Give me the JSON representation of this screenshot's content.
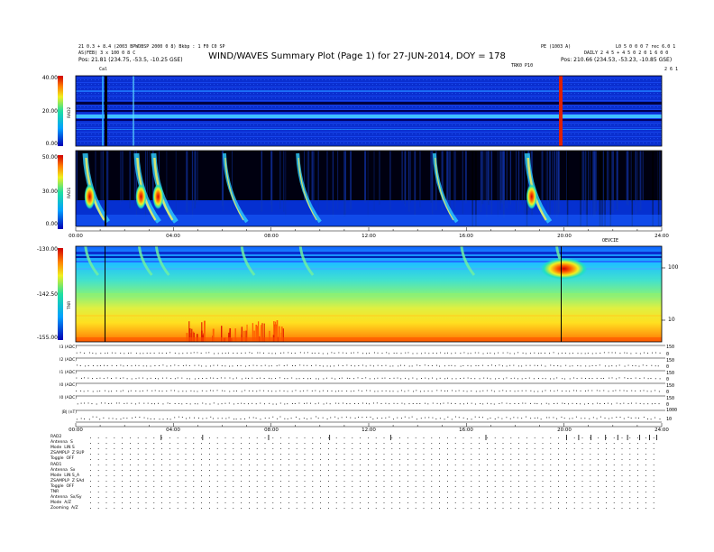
{
  "header": {
    "top_left_line1": "21 0.3 + 8.4 (2003 BPWDBSP 2000 0 8) Bkbp : 1 F0 C0 SP",
    "top_left_line2": "AS(FEB) 3 x 100 0 8 C",
    "position_left": "Pos:  21.81 (234.75, -53.5, -10.25 GSE)",
    "top_center_right": "PE (1003 A)",
    "top_right": "L0 5 0 0 0 7 rec 6.0 1",
    "daily_label": "DAILY  2 4 5 + 4 5 0 2 0 1 6 0 0",
    "position_right": "Pos:  210.66 (234.53, -53.23, -10.85 GSE)",
    "mid_marker": "TRK0 P10",
    "left_marker": "Cal",
    "top_right_tick": "2 6 1"
  },
  "title": "WIND/WAVES Summary Plot (Page 1) for 27-JUN-2014, DOY = 178",
  "panels": {
    "rad2": {
      "label": "RAD2",
      "ticks": [
        "40.00",
        "20.00",
        "0.00"
      ]
    },
    "rad1": {
      "label": "RAD1",
      "ticks": [
        "50.00",
        "30.00",
        "0.00"
      ]
    },
    "tnr": {
      "label": "TNR",
      "ticks": [
        "-130.00",
        "-142.50",
        "-155.00"
      ],
      "right_ticks": [
        "100",
        "10"
      ]
    }
  },
  "time_axis_1": [
    "00:00",
    "04:00",
    "08:00",
    "12:00",
    "16:00",
    "20:00",
    "24:00"
  ],
  "axis1_right_label": "OEVCIE",
  "time_axis_2": [
    "00:00",
    "04:00",
    "08:00",
    "12:00",
    "16:00",
    "20:00",
    "24:00"
  ],
  "small_rows": [
    {
      "label": "I3 (ADC)",
      "right_ticks": [
        "150",
        "0"
      ]
    },
    {
      "label": "I2 (ADC)",
      "right_ticks": [
        "150",
        "0"
      ]
    },
    {
      "label": "I1 (ADC)",
      "right_ticks": [
        "150",
        "0"
      ]
    },
    {
      "label": "I0 (ADC)",
      "right_ticks": [
        "150",
        "0"
      ]
    },
    {
      "label": "I0 (ADC)",
      "right_ticks": [
        "150",
        "0"
      ]
    },
    {
      "label": "|B| (nT)",
      "right_ticks": [
        "1000",
        "10"
      ]
    }
  ],
  "params": [
    {
      "label": "RAD2",
      "value": ""
    },
    {
      "label": "Antenna",
      "value": "S"
    },
    {
      "label": "Mode",
      "value": "LIN S"
    },
    {
      "label": "ZSAMPLP",
      "value": "Z SUP"
    },
    {
      "label": "Toggle",
      "value": "OFF"
    },
    {
      "label": "RAD1",
      "value": ""
    },
    {
      "label": "Antenna",
      "value": "Sx"
    },
    {
      "label": "Mode",
      "value": "LIN S_A"
    },
    {
      "label": "ZSAMPLP",
      "value": "Z SAd"
    },
    {
      "label": "Toggle",
      "value": "OFF"
    },
    {
      "label": "TNR",
      "value": ""
    },
    {
      "label": "Antenna",
      "value": "Sx/Sy"
    },
    {
      "label": "Mode",
      "value": "A/Z"
    },
    {
      "label": "Zooming",
      "value": "A/Z"
    }
  ],
  "colors": {
    "bg": "#ffffff",
    "low": "#0000b4",
    "high": "#c80000",
    "axis": "#000000"
  },
  "chart_data": [
    {
      "type": "heatmap",
      "title": "RAD2",
      "x_range_hours": [
        0,
        24
      ],
      "y_range": [
        0,
        40
      ],
      "y_ticks": [
        "40.00",
        "20.00",
        "0.00"
      ],
      "notes": "mostly low intensity (blue) with horizontal interference lines; vertical burst near 20:00"
    },
    {
      "type": "heatmap",
      "title": "RAD1",
      "x_range_hours": [
        0,
        24
      ],
      "y_range": [
        0,
        50
      ],
      "y_ticks": [
        "50.00",
        "30.00",
        "0.00"
      ],
      "bursts_hours": [
        0.5,
        2.6,
        3.3,
        6.2,
        9.2,
        14.8,
        18.6
      ]
    },
    {
      "type": "heatmap",
      "title": "TNR",
      "x_range_hours": [
        0,
        24
      ],
      "y_range": [
        -155,
        -130
      ],
      "y_ticks": [
        "-130.00",
        "-142.50",
        "-155.00"
      ],
      "bursts_hours": [
        0.4,
        2.6,
        3.3,
        6.8,
        9.2,
        15.8,
        19.7
      ]
    }
  ]
}
